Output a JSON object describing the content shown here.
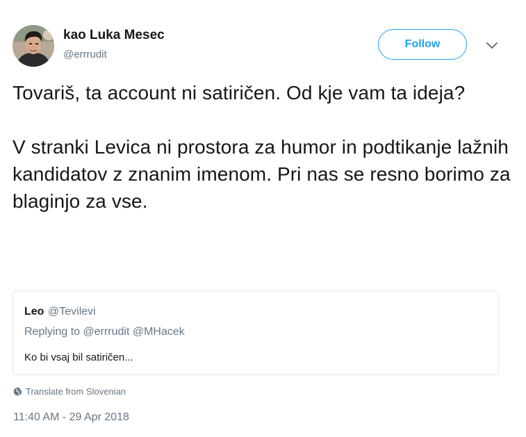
{
  "author": {
    "display_name": "kao Luka Mesec",
    "handle": "@errrudit",
    "avatar_icon": "profile-photo"
  },
  "actions": {
    "follow_label": "Follow",
    "menu_icon": "chevron-down-icon"
  },
  "tweet": {
    "paragraphs": [
      "Tovariš, ta account ni satiričen. Od kje vam ta ideja?",
      "V stranki Levica ni prostora za humor in podtikanje lažnih kandidatov z znanim imenom. Pri nas se resno borimo za blaginjo za vse."
    ],
    "translate_label": "Translate from Slovenian",
    "timestamp": "11:40 AM - 29 Apr 2018"
  },
  "quoted_tweet": {
    "name": "Leo",
    "handle": "@Tevilevi",
    "replying_to": "Replying to @errrudit @MHacek",
    "text": "Ko bi vsaj bil satiričen..."
  },
  "colors": {
    "accent": "#1da1f2",
    "text": "#14171a",
    "secondary_text": "#657786",
    "border": "#e1e8ed"
  }
}
